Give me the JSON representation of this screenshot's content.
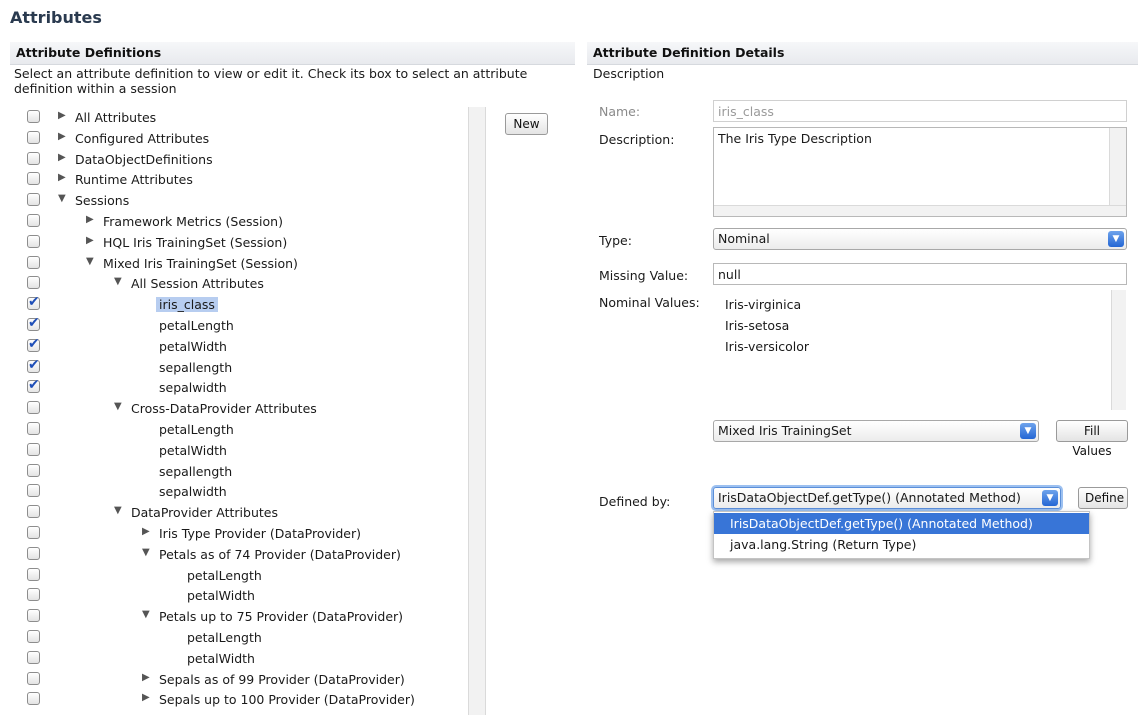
{
  "page_title": "Attributes",
  "left": {
    "header": "Attribute Definitions",
    "intro": "Select an attribute definition to view or edit it. Check its box to select an attribute definition within a session",
    "new_button": "New",
    "tree": [
      {
        "label": "All Attributes",
        "level": 0,
        "toggle": "collapsed",
        "checked": false
      },
      {
        "label": "Configured Attributes",
        "level": 0,
        "toggle": "collapsed",
        "checked": false
      },
      {
        "label": "DataObjectDefinitions",
        "level": 0,
        "toggle": "collapsed",
        "checked": false
      },
      {
        "label": "Runtime Attributes",
        "level": 0,
        "toggle": "collapsed",
        "checked": false
      },
      {
        "label": "Sessions",
        "level": 0,
        "toggle": "expanded",
        "checked": false
      },
      {
        "label": "Framework Metrics (Session)",
        "level": 1,
        "toggle": "collapsed",
        "checked": false
      },
      {
        "label": "HQL Iris TrainingSet (Session)",
        "level": 1,
        "toggle": "collapsed",
        "checked": false
      },
      {
        "label": "Mixed Iris TrainingSet (Session)",
        "level": 1,
        "toggle": "expanded",
        "checked": false
      },
      {
        "label": "All Session Attributes",
        "level": 2,
        "toggle": "expanded",
        "checked": false
      },
      {
        "label": "iris_class",
        "level": 3,
        "toggle": "none",
        "checked": true,
        "selected": true
      },
      {
        "label": "petalLength",
        "level": 3,
        "toggle": "none",
        "checked": true
      },
      {
        "label": "petalWidth",
        "level": 3,
        "toggle": "none",
        "checked": true
      },
      {
        "label": "sepallength",
        "level": 3,
        "toggle": "none",
        "checked": true
      },
      {
        "label": "sepalwidth",
        "level": 3,
        "toggle": "none",
        "checked": true
      },
      {
        "label": "Cross-DataProvider Attributes",
        "level": 2,
        "toggle": "expanded",
        "checked": false
      },
      {
        "label": "petalLength",
        "level": 3,
        "toggle": "none",
        "checked": false
      },
      {
        "label": "petalWidth",
        "level": 3,
        "toggle": "none",
        "checked": false
      },
      {
        "label": "sepallength",
        "level": 3,
        "toggle": "none",
        "checked": false
      },
      {
        "label": "sepalwidth",
        "level": 3,
        "toggle": "none",
        "checked": false
      },
      {
        "label": "DataProvider Attributes",
        "level": 2,
        "toggle": "expanded",
        "checked": false
      },
      {
        "label": "Iris Type Provider (DataProvider)",
        "level": 3,
        "toggle": "collapsed",
        "checked": false
      },
      {
        "label": "Petals as of 74 Provider (DataProvider)",
        "level": 3,
        "toggle": "expanded",
        "checked": false
      },
      {
        "label": "petalLength",
        "level": 4,
        "toggle": "none",
        "checked": false
      },
      {
        "label": "petalWidth",
        "level": 4,
        "toggle": "none",
        "checked": false
      },
      {
        "label": "Petals up to 75 Provider (DataProvider)",
        "level": 3,
        "toggle": "expanded",
        "checked": false
      },
      {
        "label": "petalLength",
        "level": 4,
        "toggle": "none",
        "checked": false
      },
      {
        "label": "petalWidth",
        "level": 4,
        "toggle": "none",
        "checked": false
      },
      {
        "label": "Sepals as of 99 Provider (DataProvider)",
        "level": 3,
        "toggle": "collapsed",
        "checked": false
      },
      {
        "label": "Sepals up to 100 Provider (DataProvider)",
        "level": 3,
        "toggle": "collapsed",
        "checked": false
      }
    ]
  },
  "right": {
    "header": "Attribute Definition Details",
    "subheader": "Description",
    "name_label": "Name:",
    "name_value": "iris_class",
    "description_label": "Description:",
    "description_value": "The Iris Type Description",
    "type_label": "Type:",
    "type_value": "Nominal",
    "missing_label": "Missing Value:",
    "missing_value": "null",
    "nominal_label": "Nominal Values:",
    "nominal_values": [
      "Iris-virginica",
      "Iris-setosa",
      "Iris-versicolor"
    ],
    "session_select": "Mixed Iris TrainingSet",
    "fill_values_button": "Fill Values",
    "defined_by_label": "Defined by:",
    "defined_by_value": "IrisDataObjectDef.getType() (Annotated Method)",
    "define_button": "Define",
    "dropdown_options": [
      {
        "label": "IrisDataObjectDef.getType() (Annotated Method)",
        "active": true
      },
      {
        "label": "java.lang.String (Return Type)",
        "active": false
      }
    ]
  },
  "colors": {
    "selection_highlight": "#b7cdf0",
    "dropdown_active": "#3875d7",
    "checkmark": "#1f4fb8"
  }
}
